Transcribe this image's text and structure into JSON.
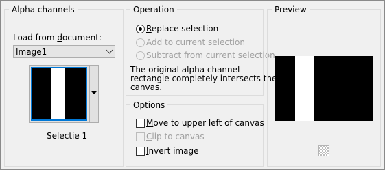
{
  "alpha_channels": {
    "title": "Alpha channels",
    "load_from_label_pre": "Load from ",
    "load_from_label_u": "d",
    "load_from_label_post": "ocument:",
    "document_value": "Image1",
    "selection_caption": "Selectie 1"
  },
  "operation": {
    "title": "Operation",
    "replace": {
      "u": "R",
      "rest": "eplace selection",
      "checked": true
    },
    "add": {
      "u": "A",
      "rest": "dd to current selection",
      "disabled": true
    },
    "subtract": {
      "u": "S",
      "rest": "ubtract from current selection",
      "disabled": true
    },
    "info_line1": "The original alpha channel",
    "info_line2": "rectangle completely intersects the",
    "info_line3": "canvas."
  },
  "options": {
    "title": "Options",
    "move": {
      "u": "M",
      "rest": "ove to upper left of canvas",
      "checked": false
    },
    "clip": {
      "u": "C",
      "rest": "lip to canvas",
      "disabled": true
    },
    "invert": {
      "u": "I",
      "rest": "nvert image",
      "checked": false
    }
  },
  "preview": {
    "title": "Preview",
    "zoom_icon": "checkerboard-icon"
  }
}
